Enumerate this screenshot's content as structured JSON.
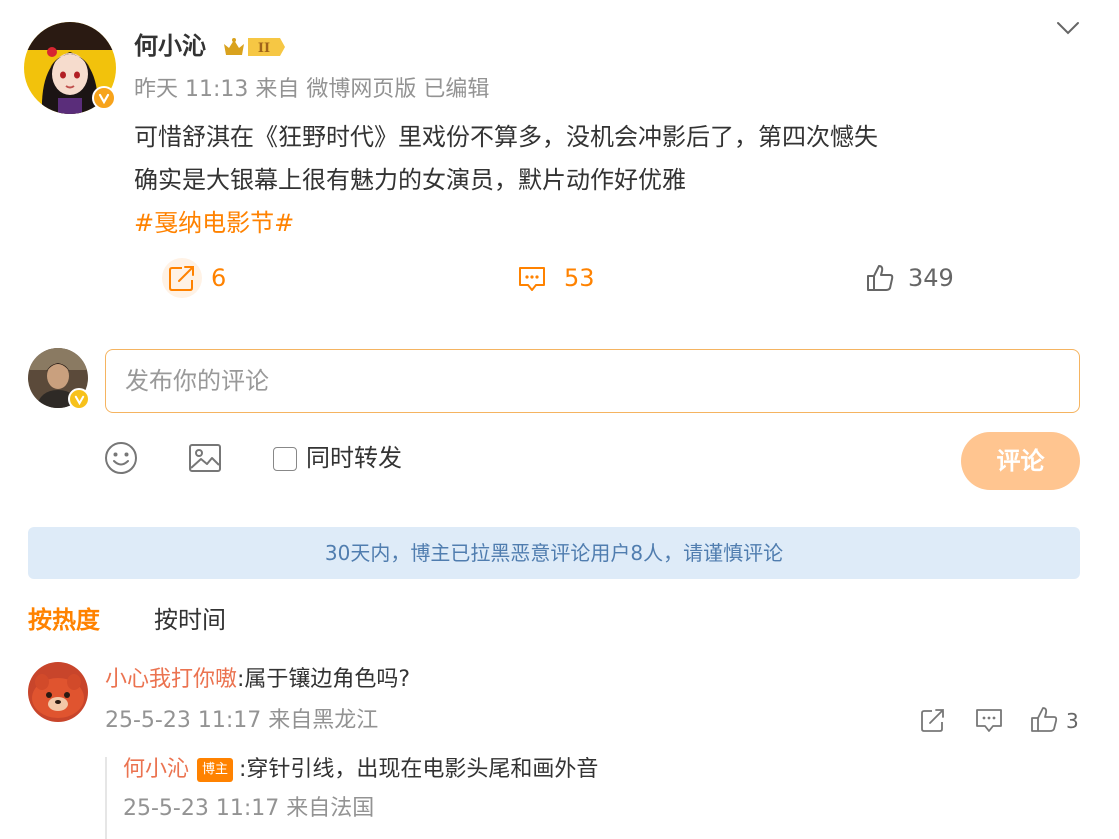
{
  "post": {
    "author": "何小沁",
    "level_badge": "II",
    "time": "昨天 11:13",
    "source": "来自 微博网页版",
    "edited": "已编辑",
    "lines": [
      "可惜舒淇在《狂野时代》里戏份不算多，没机会冲影后了，第四次憾失",
      "确实是大银幕上很有魅力的女演员，默片动作好优雅"
    ],
    "hashtag": "#戛纳电影节#",
    "repost_count": "6",
    "comment_count": "53",
    "like_count": "349"
  },
  "composer": {
    "placeholder": "发布你的评论",
    "forward_label": "同时转发",
    "submit_label": "评论"
  },
  "notice": "30天内，博主已拉黑恶意评论用户8人，请谨慎评论",
  "sort": {
    "hot": "按热度",
    "time": "按时间"
  },
  "comments": [
    {
      "user": "小心我打你嗷",
      "text": ":属于镶边角色吗?",
      "time": "25-5-23 11:17",
      "location": "来自黑龙江",
      "likes": "3",
      "replies": [
        {
          "user": "何小沁",
          "badge": "博主",
          "text": ":穿针引线，出现在电影头尾和画外音",
          "time": "25-5-23 11:17",
          "location": "来自法国"
        }
      ]
    }
  ],
  "colors": {
    "accent": "#ff8200",
    "username": "#eb7350",
    "notice_bg": "#deebf8",
    "notice_text": "#507daf",
    "submit_bg": "#ffc590"
  }
}
